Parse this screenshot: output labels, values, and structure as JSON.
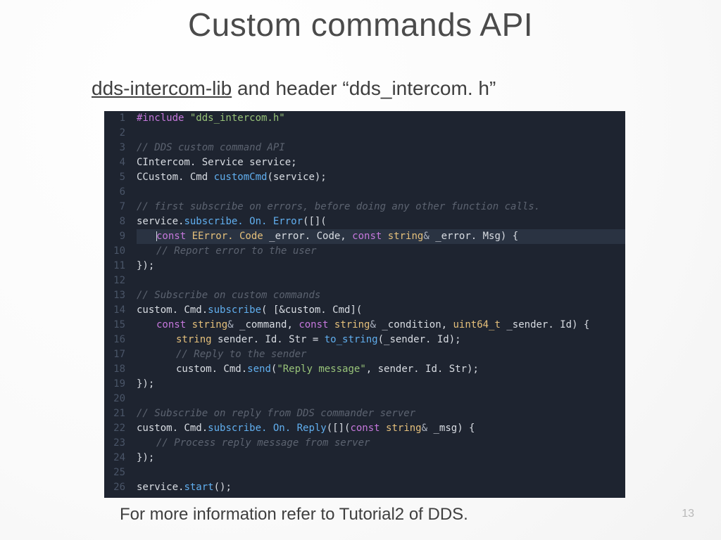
{
  "title": "Custom commands API",
  "subtitle": {
    "lib": "dds-intercom-lib",
    "rest": " and header “dds_intercom. h”"
  },
  "code": {
    "lines": [
      {
        "n": "1",
        "seg": [
          [
            "pp",
            "#include "
          ],
          [
            "str",
            "\"dds_intercom.h\""
          ]
        ]
      },
      {
        "n": "2",
        "seg": []
      },
      {
        "n": "3",
        "seg": [
          [
            "cm",
            "// DDS custom command API"
          ]
        ]
      },
      {
        "n": "4",
        "seg": [
          [
            "id",
            "CIntercom. Service service;"
          ]
        ]
      },
      {
        "n": "5",
        "seg": [
          [
            "id",
            "CCustom. Cmd "
          ],
          [
            "fn",
            "customCmd"
          ],
          [
            "id",
            "(service);"
          ]
        ]
      },
      {
        "n": "6",
        "seg": []
      },
      {
        "n": "7",
        "seg": [
          [
            "cm",
            "// first subscribe on errors, before doing any other function calls."
          ]
        ]
      },
      {
        "n": "8",
        "seg": [
          [
            "id",
            "service."
          ],
          [
            "fn",
            "subscribe. On. Error"
          ],
          [
            "id",
            "([]("
          ]
        ]
      },
      {
        "n": "9",
        "hl": true,
        "ind": 1,
        "seg": [
          [
            "kw",
            "const "
          ],
          [
            "ty",
            "EError. Code"
          ],
          [
            "id",
            " _error. Code, "
          ],
          [
            "kw",
            "const "
          ],
          [
            "ty",
            "string"
          ],
          [
            "op",
            "&"
          ],
          [
            "id",
            " _error. Msg) {"
          ]
        ]
      },
      {
        "n": "10",
        "ind": 1,
        "seg": [
          [
            "cm",
            "// Report error to the user"
          ]
        ]
      },
      {
        "n": "11",
        "seg": [
          [
            "id",
            "});"
          ]
        ]
      },
      {
        "n": "12",
        "seg": []
      },
      {
        "n": "13",
        "seg": [
          [
            "cm",
            "// Subscribe on custom commands"
          ]
        ]
      },
      {
        "n": "14",
        "seg": [
          [
            "id",
            "custom. Cmd."
          ],
          [
            "fn",
            "subscribe"
          ],
          [
            "id",
            "( [&custom. Cmd]("
          ]
        ]
      },
      {
        "n": "15",
        "ind": 1,
        "seg": [
          [
            "kw",
            "const "
          ],
          [
            "ty",
            "string"
          ],
          [
            "op",
            "&"
          ],
          [
            "id",
            " _command, "
          ],
          [
            "kw",
            "const "
          ],
          [
            "ty",
            "string"
          ],
          [
            "op",
            "&"
          ],
          [
            "id",
            " _condition, "
          ],
          [
            "ty",
            "uint64_t"
          ],
          [
            "id",
            " _sender. Id) {"
          ]
        ]
      },
      {
        "n": "16",
        "ind": 2,
        "seg": [
          [
            "ty",
            "string"
          ],
          [
            "id",
            " sender. Id. Str = "
          ],
          [
            "fn",
            "to_string"
          ],
          [
            "id",
            "(_sender. Id);"
          ]
        ]
      },
      {
        "n": "17",
        "ind": 2,
        "seg": [
          [
            "cm",
            "// Reply to the sender"
          ]
        ]
      },
      {
        "n": "18",
        "ind": 2,
        "seg": [
          [
            "id",
            "custom. Cmd."
          ],
          [
            "fn",
            "send"
          ],
          [
            "id",
            "("
          ],
          [
            "str",
            "\"Reply message\""
          ],
          [
            "id",
            ", sender. Id. Str);"
          ]
        ]
      },
      {
        "n": "19",
        "seg": [
          [
            "id",
            "});"
          ]
        ]
      },
      {
        "n": "20",
        "seg": []
      },
      {
        "n": "21",
        "seg": [
          [
            "cm",
            "// Subscribe on reply from DDS commander server"
          ]
        ]
      },
      {
        "n": "22",
        "seg": [
          [
            "id",
            "custom. Cmd."
          ],
          [
            "fn",
            "subscribe. On. Reply"
          ],
          [
            "id",
            "([]("
          ],
          [
            "kw",
            "const "
          ],
          [
            "ty",
            "string"
          ],
          [
            "op",
            "&"
          ],
          [
            "id",
            " _msg) {"
          ]
        ]
      },
      {
        "n": "23",
        "ind": 1,
        "seg": [
          [
            "cm",
            "// Process reply message from server"
          ]
        ]
      },
      {
        "n": "24",
        "seg": [
          [
            "id",
            "});"
          ]
        ]
      },
      {
        "n": "25",
        "seg": []
      },
      {
        "n": "26",
        "seg": [
          [
            "id",
            "service."
          ],
          [
            "fn",
            "start"
          ],
          [
            "id",
            "();"
          ]
        ]
      }
    ]
  },
  "footer": "For more information refer to Tutorial2 of DDS.",
  "page": "13"
}
